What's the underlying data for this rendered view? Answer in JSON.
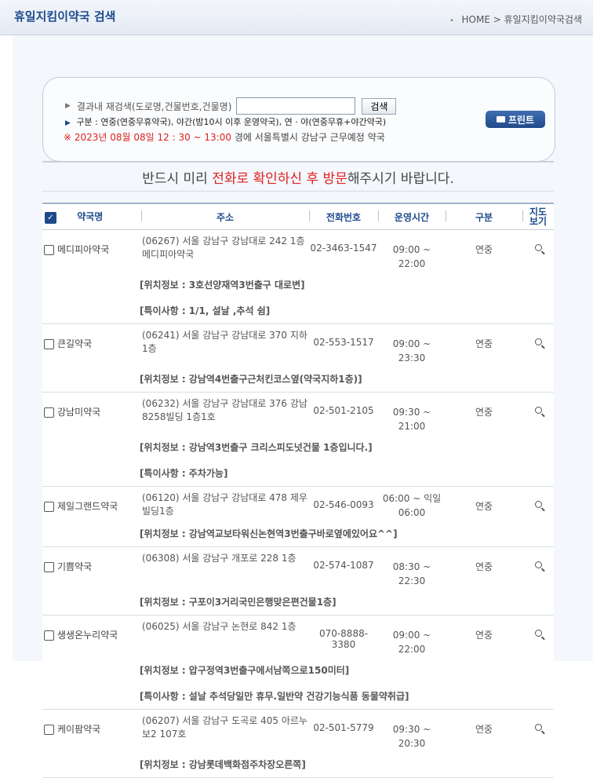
{
  "header": {
    "title": "휴일지킴이약국 검색",
    "breadcrumb": [
      "HOME",
      ">",
      "휴일지킴이약국검색"
    ]
  },
  "search": {
    "label": "결과내 재검색(도로명,건물번호,건물명)",
    "placeholder": "",
    "button": "검색",
    "legend": "구분 : 연중(연중무휴약국), 야간(밤10시 이후 운영약국), 연 · 야(연중무휴+야간약국)",
    "date_text": "※ 2023년 08월 08일 12 : 30 ~ 13:00",
    "location_text": "경에  서울특별시  강남구   근무예정 약국",
    "print_button": "프린트"
  },
  "notice": {
    "pre": "반드시 미리 ",
    "highlight": "전화로 확인하신 후 방문",
    "post": "해주시기 바랍니다."
  },
  "table": {
    "headers": [
      "약국명",
      "주소",
      "전화번호",
      "운영시간",
      "구분",
      "지도보기"
    ],
    "rows": [
      {
        "name": "메디피아약국",
        "address": "(06267) 서울 강남구 강남대로 242 1층 메디피아약국",
        "phone": "02-3463-1547",
        "hours": "09:00 ~ 22:00",
        "type": "연중",
        "infos": [
          "[위치정보 : 3호선양재역3번출구 대로변]",
          "[특이사항 : 1/1, 설날 ,추석 쉼]"
        ]
      },
      {
        "name": "큰길약국",
        "address": "(06241) 서울 강남구 강남대로 370 지하 1층",
        "phone": "02-553-1517",
        "hours": "09:00 ~ 23:30",
        "type": "연중",
        "infos": [
          "[위치정보 : 강남역4번출구근처킨코스옆(약국지하1층)]"
        ]
      },
      {
        "name": "강남미약국",
        "address": "(06232) 서울 강남구 강남대로 376 강남 8258빌딩 1층1호",
        "phone": "02-501-2105",
        "hours": "09:30 ~ 21:00",
        "type": "연중",
        "infos": [
          "[위치정보 : 강남역3번출구 크리스피도넛건물 1층입니다.]",
          "[특이사항 : 주차가능]"
        ]
      },
      {
        "name": "제일그랜드약국",
        "address": "(06120) 서울 강남구 강남대로 478 제우 빌딩1층",
        "phone": "02-546-0093",
        "hours": "06:00 ~ 익일 06:00",
        "type": "연중",
        "infos": [
          "[위치정보 : 강남역교보타워신논현역3번출구바로옆에있어요^^]"
        ]
      },
      {
        "name": "기쁨약국",
        "address": "(06308) 서울 강남구 개포로 228 1층",
        "phone": "02-574-1087",
        "hours": "08:30 ~ 22:30",
        "type": "연중",
        "infos": [
          "[위치정보 : 구포이3거리국민은행맞은편건물1층]"
        ]
      },
      {
        "name": "생생온누리약국",
        "address": "(06025) 서울 강남구 논현로 842 1층",
        "phone": "070-8888-3380",
        "hours": "09:00 ~ 22:00",
        "type": "연중",
        "infos": [
          "[위치정보 : 압구정역3번출구에서남쪽으로150미터]",
          "[특이사항 : 설날 추석당일만 휴무.일반약 건강기능식품 동물약취급]"
        ]
      },
      {
        "name": "케이팜약국",
        "address": "(06207) 서울 강남구 도곡로 405 아르누 보2 107호",
        "phone": "02-501-5779",
        "hours": "09:30 ~ 20:30",
        "type": "연중",
        "infos": [
          "[위치정보 : 강남롯데백화점주차장오른쪽]"
        ]
      }
    ]
  }
}
